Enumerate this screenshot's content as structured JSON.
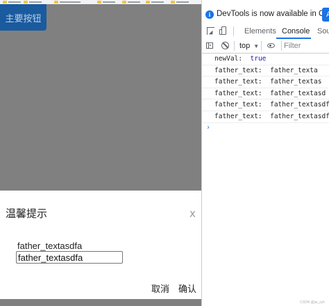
{
  "page": {
    "primary_button_label": "主要按钮"
  },
  "dialog": {
    "title": "温馨提示",
    "close_label": "x",
    "father_text": "father_textasdfa",
    "input_value": "father_textasdfa",
    "cancel_label": "取消",
    "confirm_label": "确认"
  },
  "devtools": {
    "notice_text": "DevTools is now available in Chinese!",
    "notice_button_label": "A",
    "tabs": {
      "elements": "Elements",
      "console": "Console",
      "sources": "Sour"
    },
    "toolbar": {
      "context": "top",
      "filter_placeholder": "Filter"
    },
    "logs": [
      {
        "key": "newVal:",
        "value": "true"
      },
      {
        "key": "father_text:",
        "value": "father_texta"
      },
      {
        "key": "father_text:",
        "value": "father_textas"
      },
      {
        "key": "father_text:",
        "value": "father_textasd"
      },
      {
        "key": "father_text:",
        "value": "father_textasdf"
      },
      {
        "key": "father_text:",
        "value": "father_textasdfa"
      }
    ],
    "prompt_symbol": "›"
  },
  "watermark": "CSDN @jw_zyh",
  "icons": {
    "info": "info-icon",
    "inspect": "inspect-element-icon",
    "device": "device-toggle-icon",
    "sidebar": "console-sidebar-icon",
    "clear": "clear-console-icon",
    "eye": "live-expression-eye-icon"
  },
  "colors": {
    "primary_button_bg": "#1a5a9e",
    "overlay_bg": "#808080",
    "devtools_accent": "#1a73e8"
  }
}
